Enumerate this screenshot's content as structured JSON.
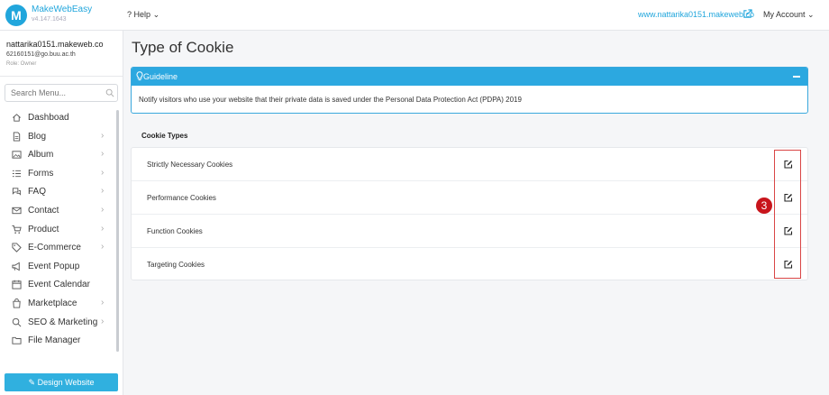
{
  "header": {
    "brand": "MakeWebEasy",
    "version": "v4.147.1643",
    "help_label": "Help",
    "site_link": "www.nattarika0151.makeweb.co",
    "account_label": "My Account"
  },
  "user": {
    "name": "nattarika0151.makeweb.co",
    "email": "62160151@go.buu.ac.th",
    "role": "Role: Owner"
  },
  "sidebar": {
    "search_placeholder": "Search Menu...",
    "items": [
      {
        "label": "Dashboad",
        "icon": "home-icon",
        "has_chevron": false
      },
      {
        "label": "Blog",
        "icon": "document-icon",
        "has_chevron": true
      },
      {
        "label": "Album",
        "icon": "image-icon",
        "has_chevron": true
      },
      {
        "label": "Forms",
        "icon": "list-icon",
        "has_chevron": true
      },
      {
        "label": "FAQ",
        "icon": "chat-icon",
        "has_chevron": true
      },
      {
        "label": "Contact",
        "icon": "mail-icon",
        "has_chevron": true
      },
      {
        "label": "Product",
        "icon": "cart-icon",
        "has_chevron": true
      },
      {
        "label": "E-Commerce",
        "icon": "tag-icon",
        "has_chevron": true
      },
      {
        "label": "Event Popup",
        "icon": "megaphone-icon",
        "has_chevron": false
      },
      {
        "label": "Event Calendar",
        "icon": "calendar-icon",
        "has_chevron": false
      },
      {
        "label": "Marketplace",
        "icon": "bag-icon",
        "has_chevron": true
      },
      {
        "label": "SEO & Marketing",
        "icon": "search-icon",
        "has_chevron": true
      },
      {
        "label": "File Manager",
        "icon": "folder-icon",
        "has_chevron": false
      }
    ],
    "design_button": "Design Website"
  },
  "main": {
    "title": "Type of Cookie",
    "guideline_title": "Guideline",
    "guideline_text": "Notify visitors who use your website that their private data is saved under the Personal Data Protection Act (PDPA) 2019",
    "section_label": "Cookie Types",
    "cookies": [
      "Strictly Necessary Cookies",
      "Performance Cookies",
      "Function Cookies",
      "Targeting Cookies"
    ],
    "step_number": "3"
  },
  "colors": {
    "accent": "#2ca8e0",
    "highlight": "#d94545",
    "badge": "#c8151c"
  }
}
